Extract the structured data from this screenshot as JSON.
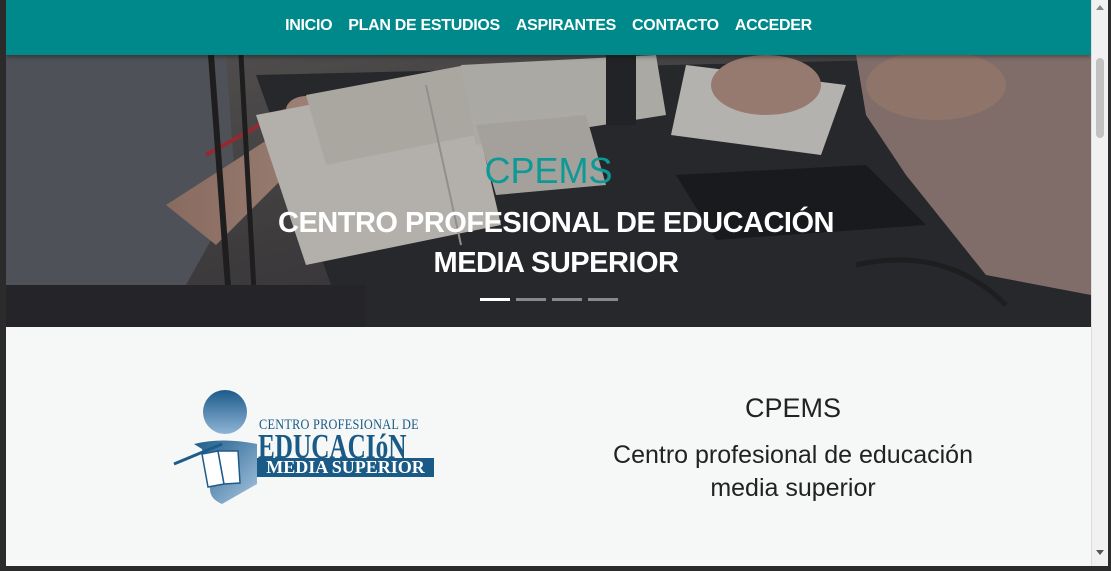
{
  "nav": {
    "items": [
      {
        "label": "INICIO"
      },
      {
        "label": "PLAN DE ESTUDIOS"
      },
      {
        "label": "ASPIRANTES"
      },
      {
        "label": "CONTACTO"
      },
      {
        "label": "ACCEDER"
      }
    ]
  },
  "hero": {
    "title": "CPEMS",
    "subtitle": "CENTRO PROFESIONAL DE EDUCACIÓN MEDIA SUPERIOR",
    "active_slide": 1,
    "slide_count": 4
  },
  "logo": {
    "line1": "CENTRO PROFESIONAL DE",
    "line2": "EDUCACIóN",
    "line3": "MEDIA SUPERIOR"
  },
  "about": {
    "title": "CPEMS",
    "description": "Centro profesional de educación media superior"
  },
  "colors": {
    "navbar": "#00898a",
    "accent_title": "#0d9a96",
    "logo_blue": "#1a5a86"
  }
}
